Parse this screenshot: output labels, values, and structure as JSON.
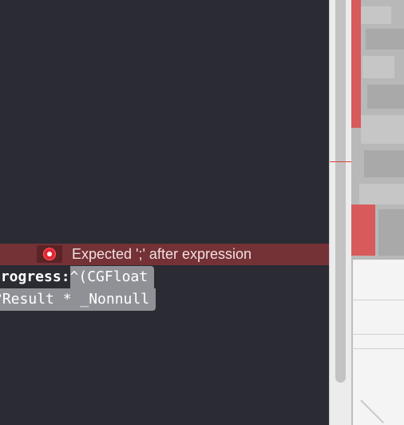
{
  "editor": {
    "error_message": "Expected ';' after expression",
    "error_icon": "error-icon",
    "code_lines": [
      {
        "label": "progress:",
        "selected": "^(CGFloat"
      },
      {
        "label": "",
        "selected": "Result * _Nonnull"
      }
    ],
    "code_line_2_prefix": "?"
  },
  "colors": {
    "editor_background": "#2a2b33",
    "error_band": "#743236",
    "error_icon": "#e22634",
    "selection": "#8f9196"
  }
}
